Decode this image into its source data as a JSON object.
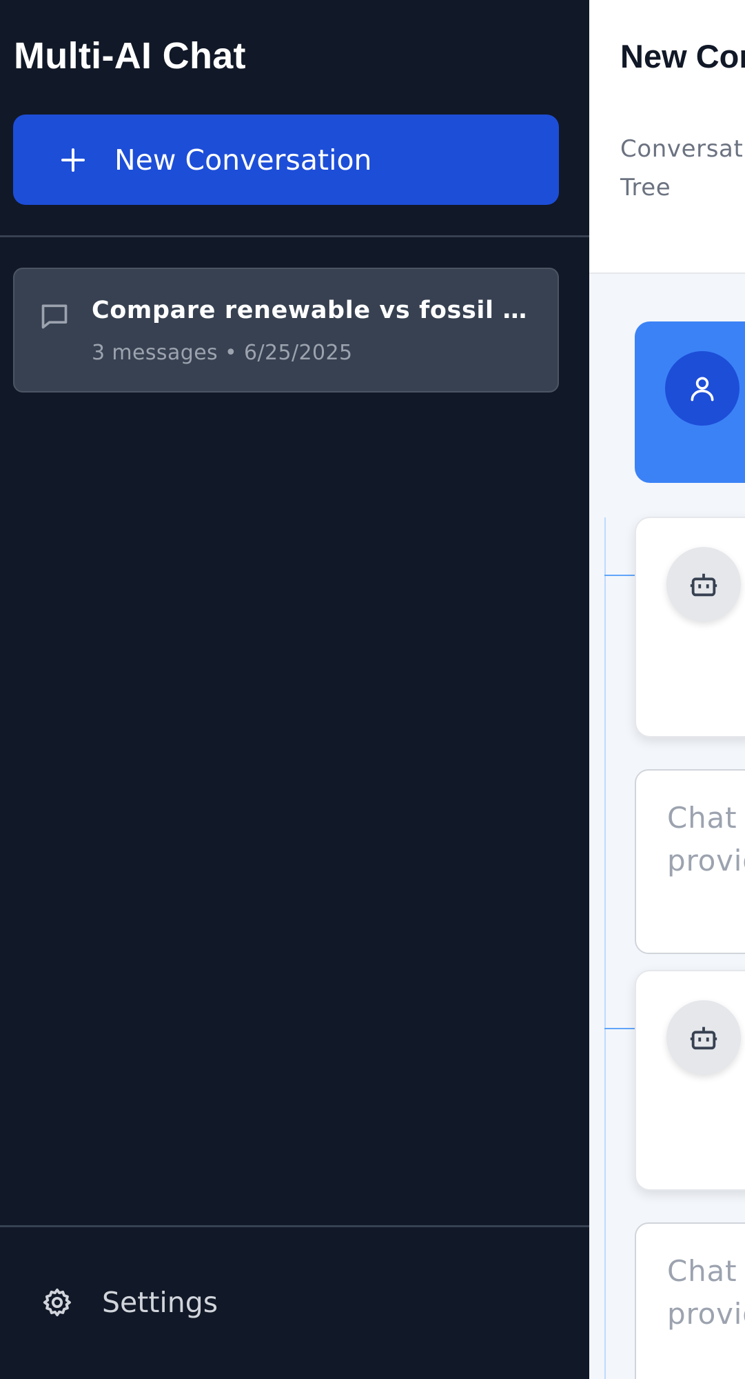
{
  "sidebar": {
    "app_title": "Multi-AI Chat",
    "new_conversation_label": "New Conversation",
    "conversations": [
      {
        "title": "Compare renewable vs fossil fuels",
        "meta": "3 messages • 6/25/2025"
      }
    ],
    "settings_label": "Settings"
  },
  "main": {
    "title": "New Conversation",
    "tree_label": "Conversation Tree",
    "input_placeholder": "Chat with provider..."
  },
  "icons": {
    "new": "plus-icon",
    "conversation": "chat-bubble-icon",
    "settings": "gear-icon",
    "user": "user-icon",
    "bot": "bot-icon"
  },
  "colors": {
    "sidebar_bg": "#111827",
    "accent": "#1d4ed8",
    "user_card": "#3b82f6",
    "item_bg": "#374151"
  }
}
